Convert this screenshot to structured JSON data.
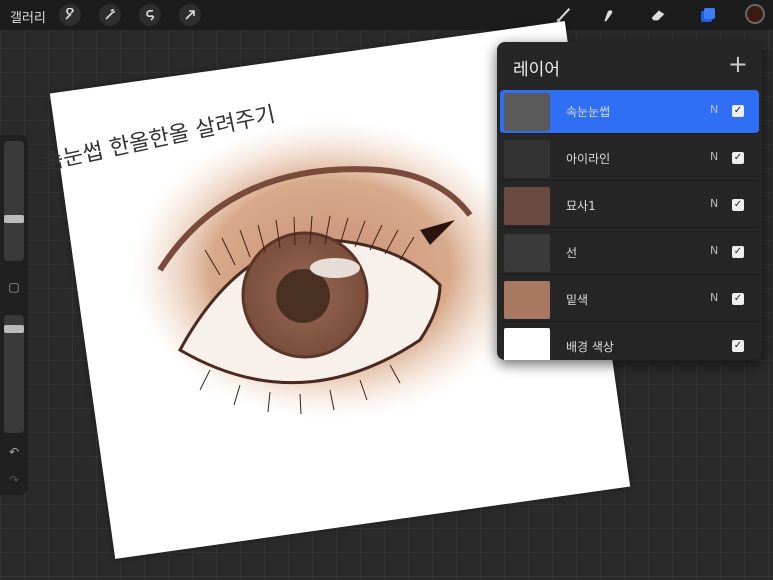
{
  "toolbar": {
    "gallery_label": "갤러리",
    "left_tools": [
      "wrench-icon",
      "magic-wand-icon",
      "selection-icon",
      "transform-arrow-icon"
    ],
    "right_tools": [
      "brush-icon",
      "smudge-icon",
      "eraser-icon",
      "layers-icon"
    ],
    "layers_accent": "#2f6ff5",
    "current_color": "#3b1a14"
  },
  "canvas": {
    "handwritten_note": "속눈썹 한올한올 살려주기"
  },
  "layers_panel": {
    "title": "레이어",
    "add_label": "+",
    "layers": [
      {
        "name": "속눈눈썹",
        "mode": "N",
        "visible": true,
        "active": true
      },
      {
        "name": "아이라인",
        "mode": "N",
        "visible": true,
        "active": false
      },
      {
        "name": "묘사1",
        "mode": "N",
        "visible": true,
        "active": false
      },
      {
        "name": "선",
        "mode": "N",
        "visible": true,
        "active": false
      },
      {
        "name": "밑색",
        "mode": "N",
        "visible": true,
        "active": false
      },
      {
        "name": "배경 색상",
        "mode": "",
        "visible": true,
        "active": false
      }
    ]
  }
}
